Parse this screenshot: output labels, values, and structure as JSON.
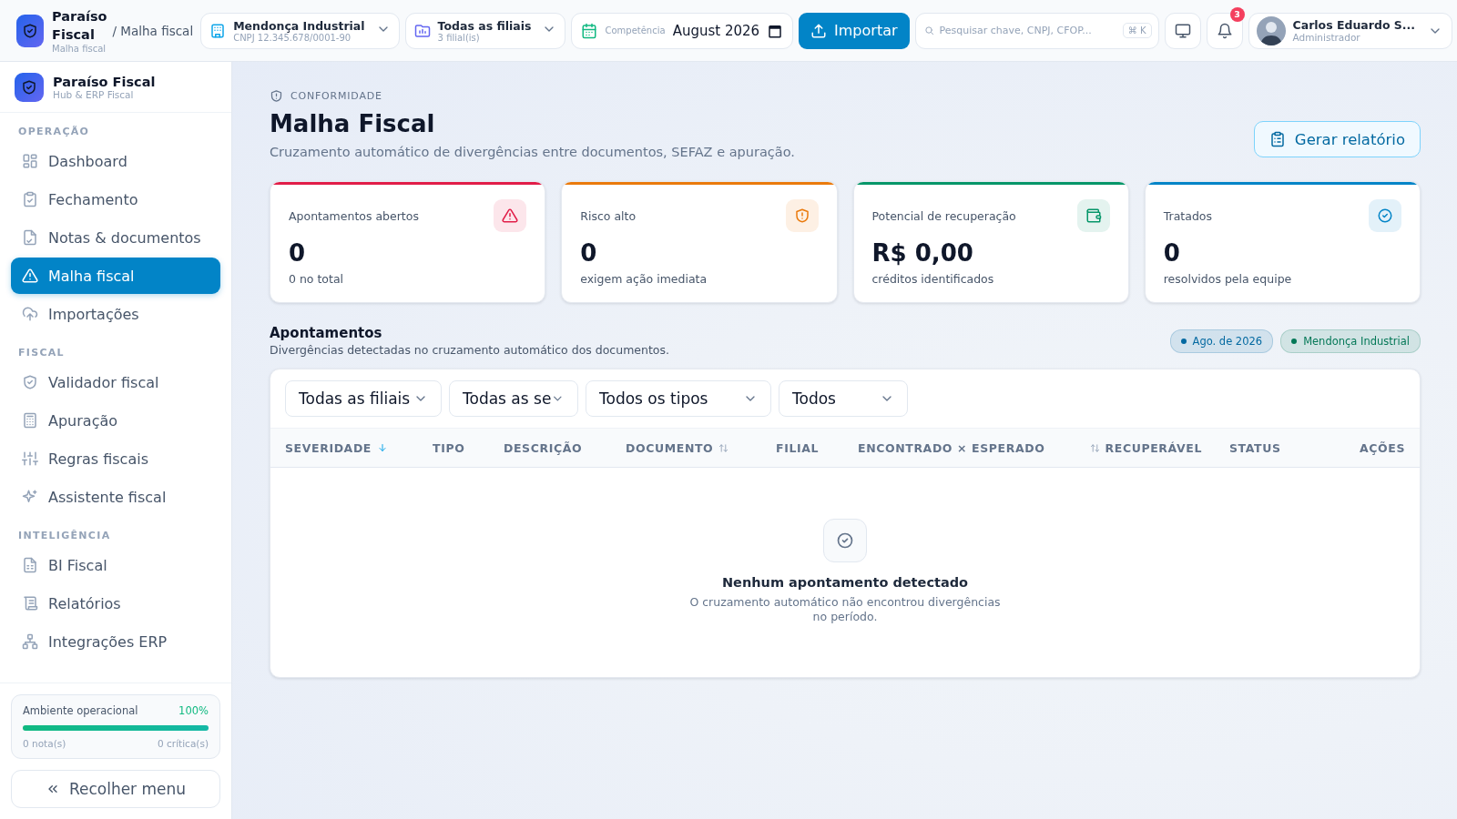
{
  "topbar": {
    "brand": {
      "name": "Paraíso Fiscal",
      "subtitle": "Malha fiscal"
    },
    "breadcrumb": "/ Malha fiscal",
    "company": {
      "name": "Mendonça Industrial",
      "detail": "CNPJ 12.345.678/0001-90"
    },
    "branches": {
      "name": "Todas as filiais",
      "detail": "3 filial(is)"
    },
    "period": {
      "label": "Competência",
      "value": "August 2026"
    },
    "import_button": "Importar",
    "search": {
      "placeholder": "Pesquisar chave, CNPJ, CFOP...",
      "shortcut": "⌘ K"
    },
    "notifications": {
      "count": "3"
    },
    "user": {
      "name": "Carlos Eduardo S...",
      "role": "Administrador"
    }
  },
  "sidebar": {
    "brand": {
      "name": "Paraíso Fiscal",
      "subtitle": "Hub & ERP Fiscal"
    },
    "sections": [
      {
        "title": "OPERAÇÃO",
        "items": [
          {
            "label": "Dashboard",
            "selected": false
          },
          {
            "label": "Fechamento",
            "selected": false
          },
          {
            "label": "Notas & documentos",
            "selected": false
          },
          {
            "label": "Malha fiscal",
            "selected": true
          },
          {
            "label": "Importações",
            "selected": false
          }
        ]
      },
      {
        "title": "FISCAL",
        "items": [
          {
            "label": "Validador fiscal",
            "selected": false
          },
          {
            "label": "Apuração",
            "selected": false
          },
          {
            "label": "Regras fiscais",
            "selected": false
          },
          {
            "label": "Assistente fiscal",
            "selected": false
          }
        ]
      },
      {
        "title": "INTELIGÊNCIA",
        "items": [
          {
            "label": "BI Fiscal",
            "selected": false
          },
          {
            "label": "Relatórios",
            "selected": false
          },
          {
            "label": "Integrações ERP",
            "selected": false
          }
        ]
      }
    ],
    "status_card": {
      "title": "Ambiente operacional",
      "reading": "100%",
      "level": 1,
      "notes": "0 nota(s)",
      "critical": "0 crítica(s)"
    },
    "collapse_button": "Recolher menu"
  },
  "page": {
    "eyebrow": "CONFORMIDADE",
    "title": "Malha Fiscal",
    "subtitle": "Cruzamento automático de divergências entre documentos, SEFAZ e apuração.",
    "report_button": "Gerar relatório",
    "stats": [
      {
        "label": "Apontamentos abertos",
        "value": "0",
        "note": "0 no total",
        "color": "#e11d48"
      },
      {
        "label": "Risco alto",
        "value": "0",
        "note": "exigem ação imediata",
        "color": "#ea7a0c"
      },
      {
        "label": "Potencial de recuperação",
        "value": "R$ 0,00",
        "note": "créditos identificados",
        "color": "#059669"
      },
      {
        "label": "Tratados",
        "value": "0",
        "note": "resolvidos pela equipe",
        "color": "#0284c7"
      }
    ],
    "findings": {
      "title": "Apontamentos",
      "subtitle": "Divergências detectadas no cruzamento automático dos documentos.",
      "chips": [
        {
          "label": "Ago. de 2026",
          "color": "#0369a1"
        },
        {
          "label": "Mendonça Industrial",
          "color": "#047857"
        }
      ],
      "filters": [
        "Todas as filiais",
        "Todas as se",
        "Todos os tipos",
        "Todos"
      ],
      "columns": [
        {
          "label": "SEVERIDADE",
          "sortable": true,
          "sorted": true
        },
        {
          "label": "TIPO",
          "sortable": false,
          "sorted": false
        },
        {
          "label": "DESCRIÇÃO",
          "sortable": false,
          "sorted": false
        },
        {
          "label": "DOCUMENTO",
          "sortable": true,
          "sorted": false
        },
        {
          "label": "FILIAL",
          "sortable": false,
          "sorted": false
        },
        {
          "label": "ENCONTRADO × ESPERADO",
          "sortable": false,
          "sorted": false
        },
        {
          "label": "RECUPERÁVEL",
          "sortable": true,
          "sorted": false,
          "numeric": true
        },
        {
          "label": "STATUS",
          "sortable": false,
          "sorted": false
        },
        {
          "label": "AÇÕES",
          "sortable": false,
          "sorted": false,
          "numeric": true
        }
      ],
      "empty": {
        "title": "Nenhum apontamento detectado",
        "message": "O cruzamento automático não encontrou divergências no período."
      }
    }
  }
}
